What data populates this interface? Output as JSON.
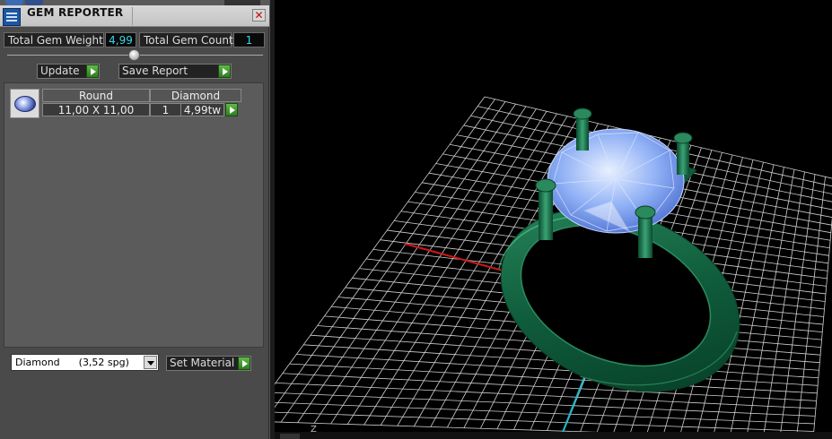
{
  "window": {
    "title": "GEM REPORTER",
    "close_symbol": "✕"
  },
  "summary": {
    "weight_label": "Total Gem Weight",
    "weight_value": "4,99",
    "count_label": "Total Gem Count",
    "count_value": "1"
  },
  "actions": {
    "update_label": "Update",
    "save_report_label": "Save Report"
  },
  "report": {
    "shape": "Round",
    "material": "Diamond",
    "size": "11,00 X 11,00",
    "count": "1",
    "weight": "4,99tw"
  },
  "material_select": {
    "selected": "Diamond      (3,52 spg)"
  },
  "set_material_label": "Set Material",
  "viewport": {
    "axis_label": "Z"
  },
  "colors": {
    "panel_bg": "#4a4a4a",
    "value_text": "#3ad6e6",
    "accent_green": "#2e7d1f",
    "ring_green": "#0f5c3b",
    "gem_blue": "#8fb0f5",
    "grid": "#cfcfcf",
    "axis_x": "#d01818",
    "axis_y": "#1fb8c8"
  }
}
